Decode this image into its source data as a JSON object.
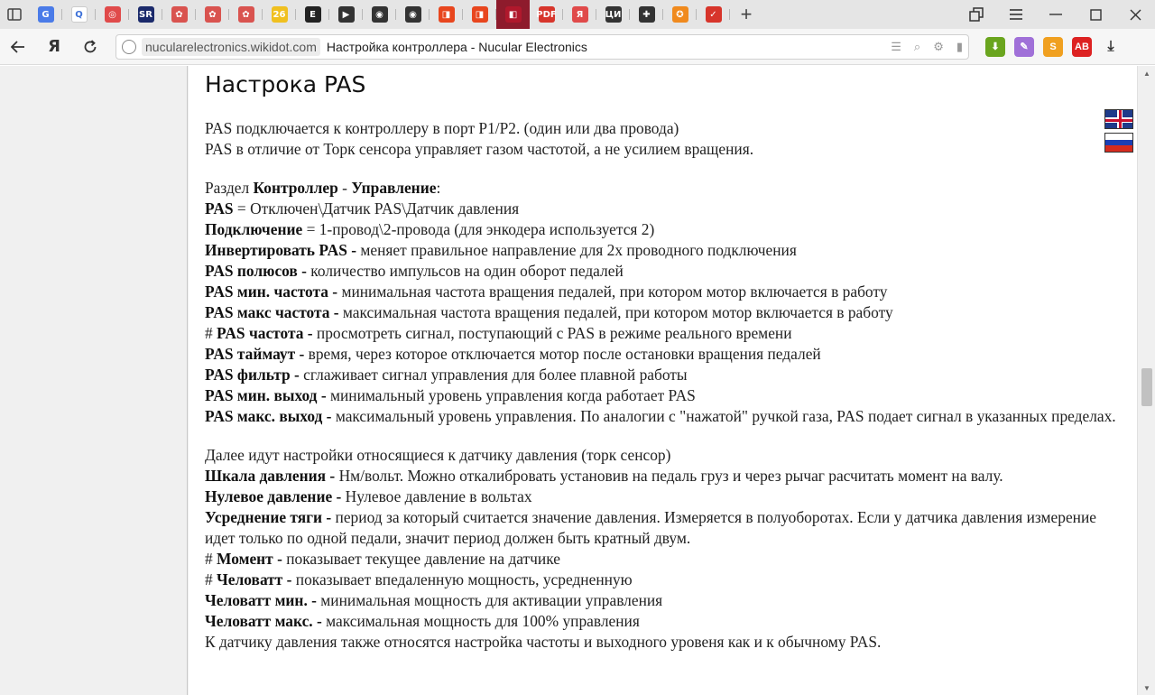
{
  "browser": {
    "address": {
      "domain": "nucularelectronics.wikidot.com",
      "title": "Настройка контроллера - Nucular Electronics"
    },
    "tabs": [
      {
        "fav": "G",
        "color": "#4a7be8"
      },
      {
        "fav": "Q",
        "color": "#ffffff"
      },
      {
        "fav": "◎",
        "color": "#e04a4a"
      },
      {
        "fav": "SR",
        "color": "#1b2a6b"
      },
      {
        "fav": "✿",
        "color": "#d9534f"
      },
      {
        "fav": "✿",
        "color": "#d9534f"
      },
      {
        "fav": "✿",
        "color": "#d9534f"
      },
      {
        "fav": "26",
        "color": "#f0c020"
      },
      {
        "fav": "E",
        "color": "#222222"
      },
      {
        "fav": "▶",
        "color": "#333333"
      },
      {
        "fav": "◉",
        "color": "#333333"
      },
      {
        "fav": "◉",
        "color": "#333333"
      },
      {
        "fav": "◨",
        "color": "#e8461e"
      },
      {
        "fav": "◨",
        "color": "#e8461e"
      },
      {
        "fav": "◧",
        "color": "#b0182c",
        "active": true
      },
      {
        "fav": "PDF",
        "color": "#d7352b"
      },
      {
        "fav": "Я",
        "color": "#e04a4a"
      },
      {
        "fav": "ЦИ",
        "color": "#333333"
      },
      {
        "fav": "✚",
        "color": "#333333"
      },
      {
        "fav": "✪",
        "color": "#f08a1e"
      },
      {
        "fav": "✓",
        "color": "#d7352b"
      }
    ],
    "ya_label": "Я"
  },
  "article": {
    "heading": "Настрока PAS",
    "intro": [
      "PAS подключается к контроллеру в порт P1/P2. (один или два провода)",
      "PAS в отличие от Торк сенсора управляет газом частотой, а не усилием вращения."
    ],
    "section_prefix": "Раздел ",
    "section_a": "Контроллер",
    "section_sep": " - ",
    "section_b": "Управление",
    "section_suffix": ":",
    "settings": [
      {
        "prefix": "",
        "name": "PAS",
        "desc": " = Отключен\\Датчик PAS\\Датчик давления"
      },
      {
        "prefix": "",
        "name": "Подключение",
        "desc": " = 1-провод\\2-провода (для энкодера используется 2)"
      },
      {
        "prefix": "",
        "name": "Инвертировать PAS -",
        "desc": " меняет правильное направление для 2х проводного подключения"
      },
      {
        "prefix": "",
        "name": "PAS полюсов -",
        "desc": " количество импульсов на один оборот педалей"
      },
      {
        "prefix": "",
        "name": "PAS мин. частота -",
        "desc": " минимальная частота вращения педалей, при котором мотор включается в работу"
      },
      {
        "prefix": "",
        "name": "PAS макс частота -",
        "desc": " максимальная частота вращения педалей, при котором мотор включается в работу"
      },
      {
        "prefix": "# ",
        "name": "PAS частота -",
        "desc": " просмотреть сигнал, поступающий с PAS в режиме реального времени"
      },
      {
        "prefix": "",
        "name": "PAS таймаут -",
        "desc": " время, через которое отключается мотор после остановки вращения педалей"
      },
      {
        "prefix": "",
        "name": "PAS фильтр -",
        "desc": " сглаживает сигнал управления для более плавной работы"
      },
      {
        "prefix": "",
        "name": "PAS мин. выход -",
        "desc": " минимальный уровень управления когда работает PAS"
      },
      {
        "prefix": "",
        "name": "PAS макс. выход -",
        "desc": " максимальный уровень управления. По аналогии с \"нажатой\" ручкой газа, PAS подает сигнал в указанных пределах.",
        "wrap": true
      }
    ],
    "torque_intro": "Далее идут настройки относящиеся к датчику давления (торк сенсор)",
    "torque": [
      {
        "prefix": "",
        "name": "Шкала давления -",
        "desc": " Нм/вольт. Можно откалибровать установив на педаль груз и через рычаг расчитать момент на валу."
      },
      {
        "prefix": "",
        "name": "Нулевое давление -",
        "desc": " Нулевое давление в вольтах"
      },
      {
        "prefix": "",
        "name": "Усреднение тяги -",
        "desc": " период за который считается значение давления. Измеряется в полуоборотах. Если у датчика давления измерение идет только по одной педали, значит период должен быть кратный двум.",
        "wrap": true
      },
      {
        "prefix": "# ",
        "name": "Момент -",
        "desc": " показывает текущее давление на датчике"
      },
      {
        "prefix": "# ",
        "name": "Человатт -",
        "desc": " показывает впедаленную мощность, усредненную"
      },
      {
        "prefix": "",
        "name": "Человатт мин. -",
        "desc": " минимальная мощность для активации управления"
      },
      {
        "prefix": "",
        "name": "Человатт макс. -",
        "desc": " максимальная мощность для 100% управления"
      }
    ],
    "torque_outro": "К датчику давления также относятся настройка частоты и выходного уровеня как и к обычному PAS."
  }
}
